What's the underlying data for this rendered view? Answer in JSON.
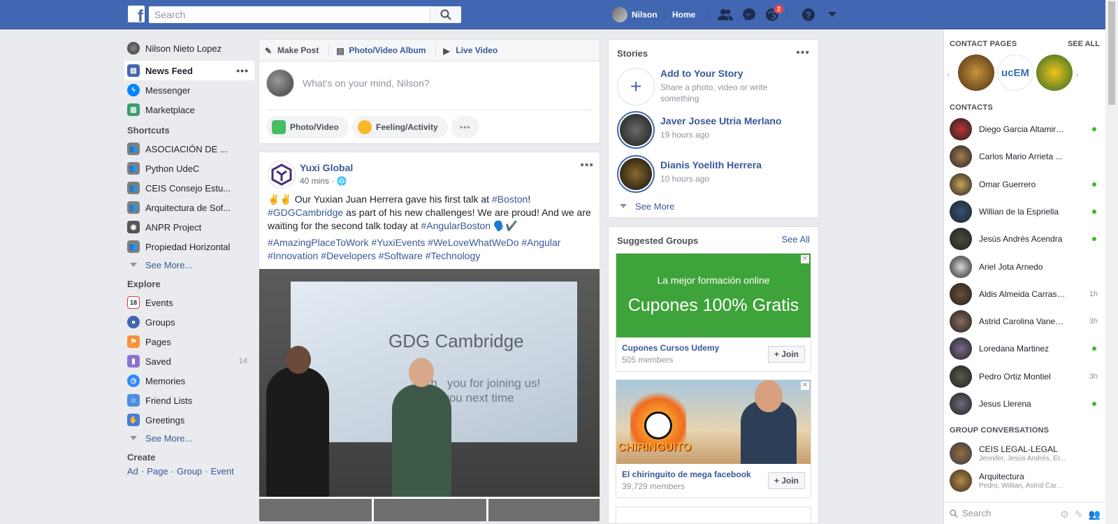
{
  "topbar": {
    "search_placeholder": "Search",
    "user_name": "Nilson",
    "home_label": "Home",
    "notifications_count": "2",
    "logo_letter": "f"
  },
  "leftnav": {
    "profile_name": "Nilson Nieto Lopez",
    "main": [
      {
        "label": "News Feed",
        "icon": "news-feed-icon"
      },
      {
        "label": "Messenger",
        "icon": "messenger-icon"
      },
      {
        "label": "Marketplace",
        "icon": "marketplace-icon"
      }
    ],
    "shortcuts_title": "Shortcuts",
    "shortcuts": [
      {
        "label": "ASOCIACIÓN DE ..."
      },
      {
        "label": "Python UdeC"
      },
      {
        "label": "CEIS Consejo Estu..."
      },
      {
        "label": "Arquitectura de Sof..."
      },
      {
        "label": "ANPR Project"
      },
      {
        "label": "Propiedad Horizontal"
      }
    ],
    "see_more": "See More...",
    "explore_title": "Explore",
    "explore": [
      {
        "label": "Events",
        "count": ""
      },
      {
        "label": "Groups",
        "count": ""
      },
      {
        "label": "Pages",
        "count": ""
      },
      {
        "label": "Saved",
        "count": "14"
      },
      {
        "label": "Memories",
        "count": ""
      },
      {
        "label": "Friend Lists",
        "count": ""
      },
      {
        "label": "Greetings",
        "count": ""
      }
    ],
    "create_title": "Create",
    "create_links": [
      "Ad",
      "Page",
      "Group",
      "Event"
    ],
    "events_day": "18"
  },
  "composer": {
    "tabs": [
      "Make Post",
      "Photo/Video Album",
      "Live Video"
    ],
    "placeholder": "What's on your mind, Nilson?",
    "actions": [
      "Photo/Video",
      "Feeling/Activity"
    ]
  },
  "post": {
    "author": "Yuxi Global",
    "time": "40 mins ·",
    "text_html": "✌️✌️ Our Yuxian Juan Herrera gave his first talk at <a>#Boston</a>! <a>#GDGCambridge</a> as part of his new challenges! We are proud! And we are waiting for the second talk today at <a>#AngularBoston</a> 🗣️✔️",
    "tags": "#AmazingPlaceToWork #YuxiEvents #WeLoveWhatWeDo #Angular #Innovation #Developers #Software #Technology",
    "photo_title": "GDG Cambridge",
    "photo_sub": "Th   you for joining us!\n   e you next time"
  },
  "stories": {
    "title": "Stories",
    "add_title": "Add to Your Story",
    "add_sub": "Share a photo, video or write something",
    "items": [
      {
        "name": "Javer Josee Utria Merlano",
        "time": "19 hours ago"
      },
      {
        "name": "Dianis Yoelith Herrera",
        "time": "10 hours ago"
      }
    ],
    "see_more": "See More"
  },
  "suggested": {
    "title": "Suggested Groups",
    "see_all": "See All",
    "groups": [
      {
        "name": "Cupones Cursos Udemy",
        "members": "505 members",
        "banner_line1": "La mejor formación online",
        "banner_line2": "Cupones 100% Gratis"
      },
      {
        "name": "El chiringuito de mega facebook",
        "members": "39,729 members",
        "banner_text": "CHIRINGUITO"
      }
    ],
    "join_label": "Join"
  },
  "chat": {
    "contact_pages_title": "CONTACT PAGES",
    "see_all": "SEE ALL",
    "contacts_title": "CONTACTS",
    "contacts": [
      {
        "name": "Diego Garcia Altamiranda",
        "status": "online"
      },
      {
        "name": "Carlos Mario Arrieta ...",
        "status": ""
      },
      {
        "name": "Omar Guerrero",
        "status": "online"
      },
      {
        "name": "Willian de la Espriella",
        "status": "online"
      },
      {
        "name": "Jesús Andrés Acendra",
        "status": "online"
      },
      {
        "name": "Ariel Jota Arnedo",
        "status": ""
      },
      {
        "name": "Aldis Almeida Carrascal",
        "status": "1h"
      },
      {
        "name": "Astrid Carolina Vanegas",
        "status": "3h"
      },
      {
        "name": "Loredana Martinez",
        "status": "online"
      },
      {
        "name": "Pedro Ortiz Montiel",
        "status": "3h"
      },
      {
        "name": "Jesus Llerena",
        "status": "online"
      }
    ],
    "group_title": "GROUP CONVERSATIONS",
    "groups": [
      {
        "name": "CEIS LEGAL-LEGAL",
        "members": "Jennifer, Jesús Andrés, Er..."
      },
      {
        "name": "Arquitectura",
        "members": "Pedro, Willian, Astrid Caro..."
      }
    ],
    "search_placeholder": "Search"
  },
  "colors": {
    "brand": "#4267b2",
    "link": "#385898",
    "online": "#42b72a",
    "badge": "#fa3e3e"
  }
}
